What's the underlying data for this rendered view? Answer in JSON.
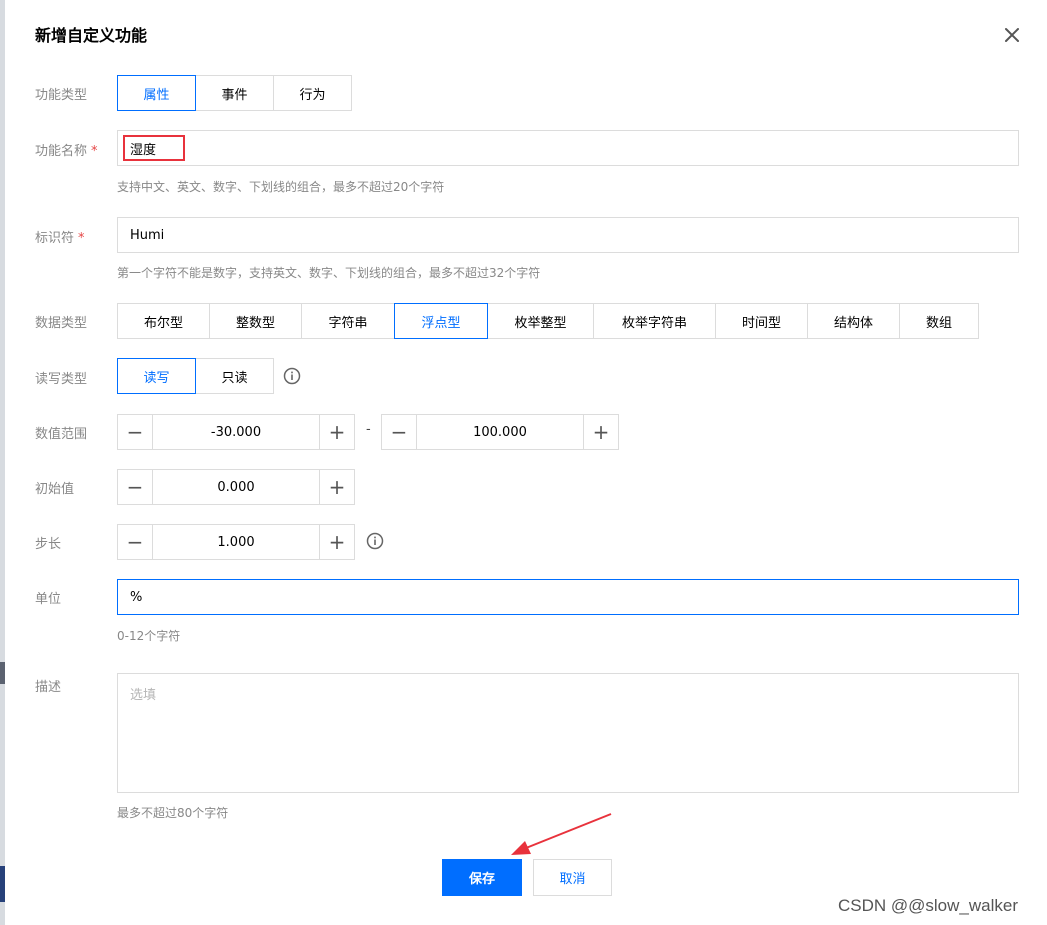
{
  "dialog": {
    "title": "新增自定义功能"
  },
  "function_type": {
    "label": "功能类型",
    "options": [
      "属性",
      "事件",
      "行为"
    ],
    "selected": "属性"
  },
  "function_name": {
    "label": "功能名称",
    "required_mark": "*",
    "value": "湿度",
    "hint": "支持中文、英文、数字、下划线的组合，最多不超过20个字符"
  },
  "identifier": {
    "label": "标识符",
    "required_mark": "*",
    "value": "Humi",
    "hint": "第一个字符不能是数字，支持英文、数字、下划线的组合，最多不超过32个字符"
  },
  "data_type": {
    "label": "数据类型",
    "options": [
      "布尔型",
      "整数型",
      "字符串",
      "浮点型",
      "枚举整型",
      "枚举字符串",
      "时间型",
      "结构体",
      "数组"
    ],
    "selected": "浮点型"
  },
  "rw_type": {
    "label": "读写类型",
    "options": [
      "读写",
      "只读"
    ],
    "selected": "读写"
  },
  "value_range": {
    "label": "数值范围",
    "min": "-30.000",
    "separator": "-",
    "max": "100.000"
  },
  "initial_value": {
    "label": "初始值",
    "value": "0.000"
  },
  "step": {
    "label": "步长",
    "value": "1.000"
  },
  "unit": {
    "label": "单位",
    "value": "%",
    "hint": "0-12个字符"
  },
  "description": {
    "label": "描述",
    "placeholder": "选填",
    "hint": "最多不超过80个字符"
  },
  "footer": {
    "save_label": "保存",
    "cancel_label": "取消"
  },
  "stepper_symbols": {
    "minus": "−",
    "plus": "+"
  },
  "watermark": "CSDN @@slow_walker",
  "colors": {
    "primary": "#006eff",
    "required": "#e54545",
    "annotation": "#e8323c"
  }
}
